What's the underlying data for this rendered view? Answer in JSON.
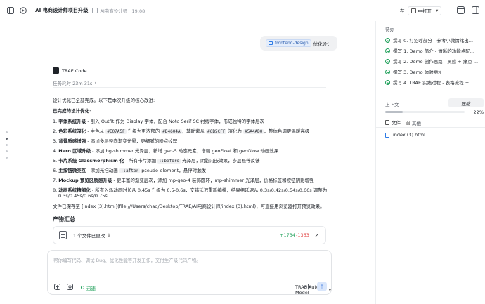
{
  "header": {
    "title": "AI 电商设计师项目升级",
    "subtitle": "AI电商设计师 · 19:08",
    "open_in_label": "在",
    "open_with_label": "中打开"
  },
  "todo": {
    "section_title": "待办",
    "items": [
      "撰写 0. 打招呼部分 - 参考小微情绪出...",
      "撰写 1. Demo 简介 - 清晰的功能点配...",
      "撰写 2. Demo 创作思路 - 灵感 + 痛点 ...",
      "撰写 3. Demo 体验地址",
      "撰写 4. TRAE 实践过程 - 表格流程 + ..."
    ]
  },
  "context": {
    "label": "上下文",
    "compress_label": "压缩",
    "usage_percent": 22,
    "usage_text": "22%"
  },
  "right_tabs": {
    "files_label": "文件",
    "other_label": "其他"
  },
  "files": [
    "index (3).html"
  ],
  "user_message": {
    "tag": "frontend-design",
    "text": "优化设计"
  },
  "assistant": {
    "name": "TRAE Code",
    "duration": "任务耗时 23m 31s",
    "intro": "设计优化已全部完成。以下是本次升级的核心改进:",
    "done_title": "已完成的设计优化:",
    "items": [
      {
        "num": "1.",
        "title": "字体系统升级",
        "rest": " - 引入 Outfit 作为 Display 字体，配合 Noto Serif SC 衬线字体，形成独特的字体层次"
      },
      {
        "num": "2.",
        "title": "色彩系统深化",
        "rest_a": " - 主色从 ",
        "code_a": "#E07A5F",
        "rest_b": " 升级为更浓郁的 ",
        "code_b": "#D4604A",
        "rest_c": "，辅助紫从 ",
        "code_c": "#6B5CFF",
        "rest_d": " 深化为 ",
        "code_d": "#5A4AD0",
        "rest_e": "，整体色调更温暖高级"
      },
      {
        "num": "3.",
        "title": "背景质感增强",
        "rest": " - 添加多层径向渐变光晕，更细腻的噪点纹理"
      },
      {
        "num": "4.",
        "title": "Hero 区域升级",
        "rest": " - 添加 bg-shimmer 光泽层，新增 geo-5 动态元素，增强 geoFloat 和 geoGlow 动画效果"
      },
      {
        "num": "5.",
        "title": "卡片系统 Glassmorphism 化",
        "rest_a": " - 所有卡片添加 ",
        "code_a": "::before",
        "rest_b": " 光泽层，阴影内嵌效果，多层悬停反馈"
      },
      {
        "num": "6.",
        "title": "主按钮微交互",
        "rest_a": " - 添加光扫动画 ",
        "code_a": "::after",
        "rest_b": " pseudo-element，悬停时触发"
      },
      {
        "num": "7.",
        "title": "Mockup 预览区质感升级",
        "rest": " - 更丰富的渐变层次，添加 mp-geo-4 装饰圆环，mp-shimmer 光泽层，价格标签和按钮阴影增强"
      },
      {
        "num": "8.",
        "title": "动画系统精细化",
        "rest": " - 所有入场动画时长从 0.45s 升级为 0.5-0.6s，交错延迟重新编排，结果组延迟从 0.3s/0.42s/0.54s/0.66s 调整为",
        "rest2": "0.3s/0.45s/0.6s/0.75s"
      }
    ],
    "saved_note": "文件已保存至 [index (3).html](file:///Users/chad/Desktop/TRAE/AI电商设计师/index (3).html)，可直接用浏览器打开预览效果。",
    "artifacts_title": "产物汇总",
    "artifact_label": "1 个文件已更改",
    "added": "+1734",
    "removed": "-1363"
  },
  "composer": {
    "placeholder": "帮你编写代码、调试 Bug、优化性能等开发工作，交付生产级代码产物。",
    "speed_label": "迅速",
    "model_label": "TRAE Auto Model"
  }
}
